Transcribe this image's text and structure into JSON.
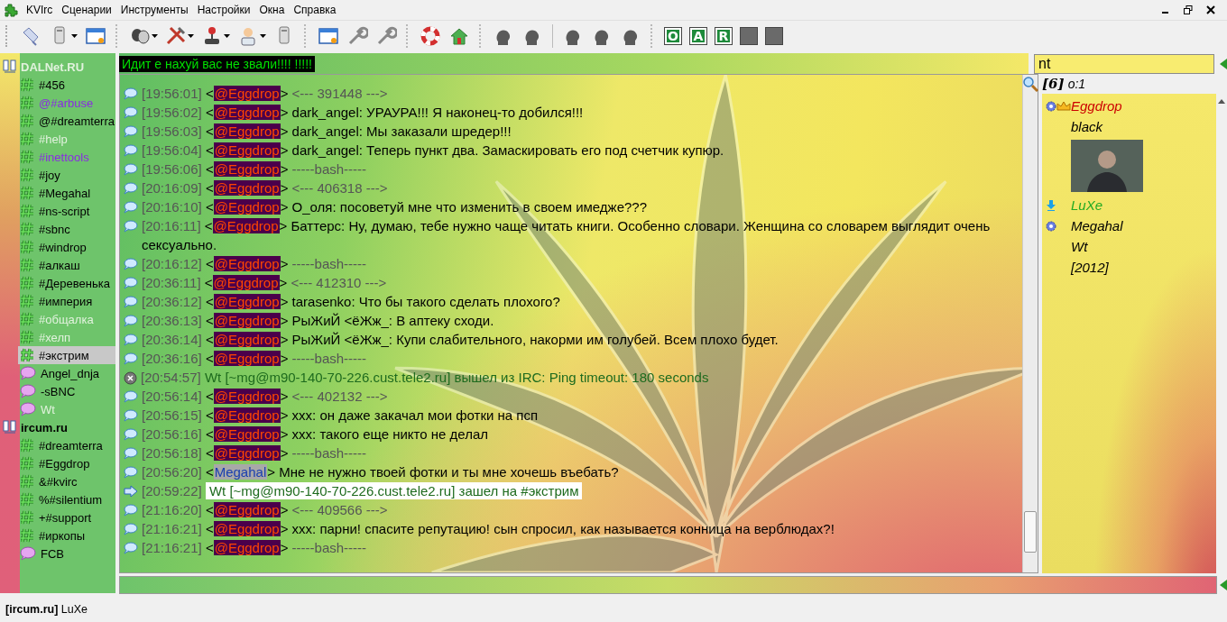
{
  "menu": [
    {
      "label": "KVIrc",
      "kind": "app"
    },
    {
      "label": "Сценарии",
      "kind": "menu"
    },
    {
      "label": "Инструменты",
      "kind": "menu"
    },
    {
      "label": "Настройки",
      "kind": "menu"
    },
    {
      "label": "Окна",
      "kind": "menu"
    },
    {
      "label": "Справка",
      "kind": "menu"
    }
  ],
  "mode_buttons": [
    {
      "label": "O",
      "enabled": true
    },
    {
      "label": "A",
      "enabled": true
    },
    {
      "label": "R",
      "enabled": true
    },
    {
      "enabled": false
    },
    {
      "enabled": false
    }
  ],
  "topic": "Идит е нахуй вас  не звали!!!! !!!!!",
  "tree": [
    {
      "label": "DALNet.RU",
      "active": false,
      "children": [
        {
          "label": "#456",
          "kind": "channel",
          "color": "#000000",
          "selected": false
        },
        {
          "label": "@#arbuse",
          "kind": "channel",
          "color": "#8a2be2",
          "selected": false
        },
        {
          "label": "@#dreamterra",
          "kind": "channel",
          "color": "#000000",
          "selected": false
        },
        {
          "label": "#help",
          "kind": "channel",
          "color": "#e2f2de",
          "selected": false
        },
        {
          "label": "#inettools",
          "kind": "channel",
          "color": "#8a2be2",
          "selected": false
        },
        {
          "label": "#joy",
          "kind": "channel",
          "color": "#000000",
          "selected": false
        },
        {
          "label": "#Megahal",
          "kind": "channel",
          "color": "#000000",
          "selected": false
        },
        {
          "label": "#ns-script",
          "kind": "channel",
          "color": "#000000",
          "selected": false
        },
        {
          "label": "#sbnc",
          "kind": "channel",
          "color": "#000000",
          "selected": false
        },
        {
          "label": "#windrop",
          "kind": "channel",
          "color": "#000000",
          "selected": false
        },
        {
          "label": "#алкаш",
          "kind": "channel",
          "color": "#000000",
          "selected": false
        },
        {
          "label": "#Деревенька",
          "kind": "channel",
          "color": "#000000",
          "selected": false
        },
        {
          "label": "#империя",
          "kind": "channel",
          "color": "#000000",
          "selected": false
        },
        {
          "label": "#общалка",
          "kind": "channel",
          "color": "#e2f2de",
          "selected": false
        },
        {
          "label": "#хелп",
          "kind": "channel",
          "color": "#e2f2de",
          "selected": false
        },
        {
          "label": "#экстрим",
          "kind": "channel",
          "color": "#000000",
          "selected": true
        },
        {
          "label": "Angel_dnja",
          "kind": "query",
          "color": "#000000",
          "selected": false
        },
        {
          "label": "-sBNC",
          "kind": "query",
          "color": "#000000",
          "selected": false
        },
        {
          "label": "Wt",
          "kind": "query",
          "color": "#e2f2de",
          "selected": false
        }
      ]
    },
    {
      "label": "ircum.ru",
      "active": true,
      "children": [
        {
          "label": "#dreamterra",
          "kind": "channel",
          "color": "#000000",
          "selected": false
        },
        {
          "label": "#Eggdrop",
          "kind": "channel",
          "color": "#000000",
          "selected": false
        },
        {
          "label": "&#kvirc",
          "kind": "channel",
          "color": "#000000",
          "selected": false
        },
        {
          "label": "%#silentium",
          "kind": "channel",
          "color": "#000000",
          "selected": false
        },
        {
          "label": "+#support",
          "kind": "channel",
          "color": "#000000",
          "selected": false
        },
        {
          "label": "#иркопы",
          "kind": "channel",
          "color": "#000000",
          "selected": false
        },
        {
          "label": "FCB",
          "kind": "query",
          "color": "#000000",
          "selected": false
        }
      ]
    }
  ],
  "messages": [
    {
      "kind": "msg",
      "time": "[19:56:01]",
      "open": "<",
      "nick": {
        "text": "@Eggdrop",
        "kind": "op"
      },
      "close": ">",
      "text": "<--- 391448 --->",
      "dim": true
    },
    {
      "kind": "msg",
      "time": "[19:56:02]",
      "open": "<",
      "nick": {
        "text": "@Eggdrop",
        "kind": "op"
      },
      "close": ">",
      "text": "dark_angel: УРАУРА!!! Я наконец-то добился!!!",
      "dim": false
    },
    {
      "kind": "msg",
      "time": "[19:56:03]",
      "open": "<",
      "nick": {
        "text": "@Eggdrop",
        "kind": "op"
      },
      "close": ">",
      "text": "dark_angel: Мы заказали шредер!!!",
      "dim": false
    },
    {
      "kind": "msg",
      "time": "[19:56:04]",
      "open": "<",
      "nick": {
        "text": "@Eggdrop",
        "kind": "op"
      },
      "close": ">",
      "text": "dark_angel: Теперь пункт два. Замаскировать его под счетчик купюр.",
      "dim": false
    },
    {
      "kind": "msg",
      "time": "[19:56:06]",
      "open": "<",
      "nick": {
        "text": "@Eggdrop",
        "kind": "op"
      },
      "close": ">",
      "text": "-----bash-----",
      "dim": true
    },
    {
      "kind": "msg",
      "time": "[20:16:09]",
      "open": "<",
      "nick": {
        "text": "@Eggdrop",
        "kind": "op"
      },
      "close": ">",
      "text": "<--- 406318 --->",
      "dim": true
    },
    {
      "kind": "msg",
      "time": "[20:16:10]",
      "open": "<",
      "nick": {
        "text": "@Eggdrop",
        "kind": "op"
      },
      "close": ">",
      "text": "О_оля: посоветуй мне что изменить в своем имедже???",
      "dim": false
    },
    {
      "kind": "msg",
      "time": "[20:16:11]",
      "open": "<",
      "nick": {
        "text": "@Eggdrop",
        "kind": "op"
      },
      "close": ">",
      "text": "Баттерс: Ну, думаю, тебе нужно чаще читать книги. Особенно словари. Женщина со словарем выглядит очень сексуально.",
      "dim": false
    },
    {
      "kind": "msg",
      "time": "[20:16:12]",
      "open": "<",
      "nick": {
        "text": "@Eggdrop",
        "kind": "op"
      },
      "close": ">",
      "text": "-----bash-----",
      "dim": true
    },
    {
      "kind": "msg",
      "time": "[20:36:11]",
      "open": "<",
      "nick": {
        "text": "@Eggdrop",
        "kind": "op"
      },
      "close": ">",
      "text": "<--- 412310 --->",
      "dim": true
    },
    {
      "kind": "msg",
      "time": "[20:36:12]",
      "open": "<",
      "nick": {
        "text": "@Eggdrop",
        "kind": "op"
      },
      "close": ">",
      "text": "tarasenko: Что бы такого сделать плохого?",
      "dim": false
    },
    {
      "kind": "msg",
      "time": "[20:36:13]",
      "open": "<",
      "nick": {
        "text": "@Eggdrop",
        "kind": "op"
      },
      "close": ">",
      "text": "РыЖиЙ <ёЖж_: В аптеку сходи.",
      "dim": false
    },
    {
      "kind": "msg",
      "time": "[20:36:14]",
      "open": "<",
      "nick": {
        "text": "@Eggdrop",
        "kind": "op"
      },
      "close": ">",
      "text": "РыЖиЙ <ёЖж_: Купи слабительного, накорми им голубей. Всем плохо будет.",
      "dim": false
    },
    {
      "kind": "msg",
      "time": "[20:36:16]",
      "open": "<",
      "nick": {
        "text": "@Eggdrop",
        "kind": "op"
      },
      "close": ">",
      "text": "-----bash-----",
      "dim": true
    },
    {
      "kind": "quit",
      "time": "[20:54:57]",
      "text": "Wt [~mg@m90-140-70-226.cust.tele2.ru] вышел из IRC: Ping timeout: 180 seconds"
    },
    {
      "kind": "msg",
      "time": "[20:56:14]",
      "open": "<",
      "nick": {
        "text": "@Eggdrop",
        "kind": "op"
      },
      "close": ">",
      "text": "<--- 402132 --->",
      "dim": true
    },
    {
      "kind": "msg",
      "time": "[20:56:15]",
      "open": "<",
      "nick": {
        "text": "@Eggdrop",
        "kind": "op"
      },
      "close": ">",
      "text": "xxx: он даже закачал мои фотки на псп",
      "dim": false
    },
    {
      "kind": "msg",
      "time": "[20:56:16]",
      "open": "<",
      "nick": {
        "text": "@Eggdrop",
        "kind": "op"
      },
      "close": ">",
      "text": "xxx: такого еще никто не делал",
      "dim": false
    },
    {
      "kind": "msg",
      "time": "[20:56:18]",
      "open": "<",
      "nick": {
        "text": "@Eggdrop",
        "kind": "op"
      },
      "close": ">",
      "text": "-----bash-----",
      "dim": true
    },
    {
      "kind": "msg",
      "time": "[20:56:20]",
      "open": "<",
      "nick": {
        "text": "Megahal",
        "kind": "plain"
      },
      "close": ">",
      "text": "Мне не нужно твоей фотки и ты мне хочешь въебать?",
      "dim": false
    },
    {
      "kind": "join",
      "time": "[20:59:22]",
      "text": "Wt [~mg@m90-140-70-226.cust.tele2.ru] зашел на #экстрим"
    },
    {
      "kind": "msg",
      "time": "[21:16:20]",
      "open": "<",
      "nick": {
        "text": "@Eggdrop",
        "kind": "op"
      },
      "close": ">",
      "text": "<--- 409566 --->",
      "dim": true
    },
    {
      "kind": "msg",
      "time": "[21:16:21]",
      "open": "<",
      "nick": {
        "text": "@Eggdrop",
        "kind": "op"
      },
      "close": ">",
      "text": "xxx: парни! спасите репутацию! сын спросил, как называется конница на верблюдах?!",
      "dim": false
    },
    {
      "kind": "msg",
      "time": "[21:16:21]",
      "open": "<",
      "nick": {
        "text": "@Eggdrop",
        "kind": "op"
      },
      "close": ">",
      "text": "-----bash-----",
      "dim": true
    }
  ],
  "search": {
    "value": "nt"
  },
  "nick_header": {
    "count": "[6]",
    "ops": "o:1"
  },
  "users": [
    {
      "kind": "user",
      "name": "Eggdrop",
      "color": "#cc0000",
      "oper": true,
      "owner": true,
      "voice": false
    },
    {
      "kind": "user",
      "name": "black",
      "color": "#000000",
      "oper": false,
      "owner": false,
      "voice": false
    },
    {
      "kind": "avatar"
    },
    {
      "kind": "user",
      "name": "LuXe",
      "color": "#22aa22",
      "oper": false,
      "owner": false,
      "voice": true
    },
    {
      "kind": "user",
      "name": "Megahal",
      "color": "#000000",
      "oper": true,
      "owner": false,
      "voice": false
    },
    {
      "kind": "user",
      "name": "Wt",
      "color": "#000000",
      "oper": false,
      "owner": false,
      "voice": false
    },
    {
      "kind": "user",
      "name": "[2012]",
      "color": "#000000",
      "oper": false,
      "owner": false,
      "voice": false
    }
  ],
  "status": "**[ircum.ru]** LuXe"
}
